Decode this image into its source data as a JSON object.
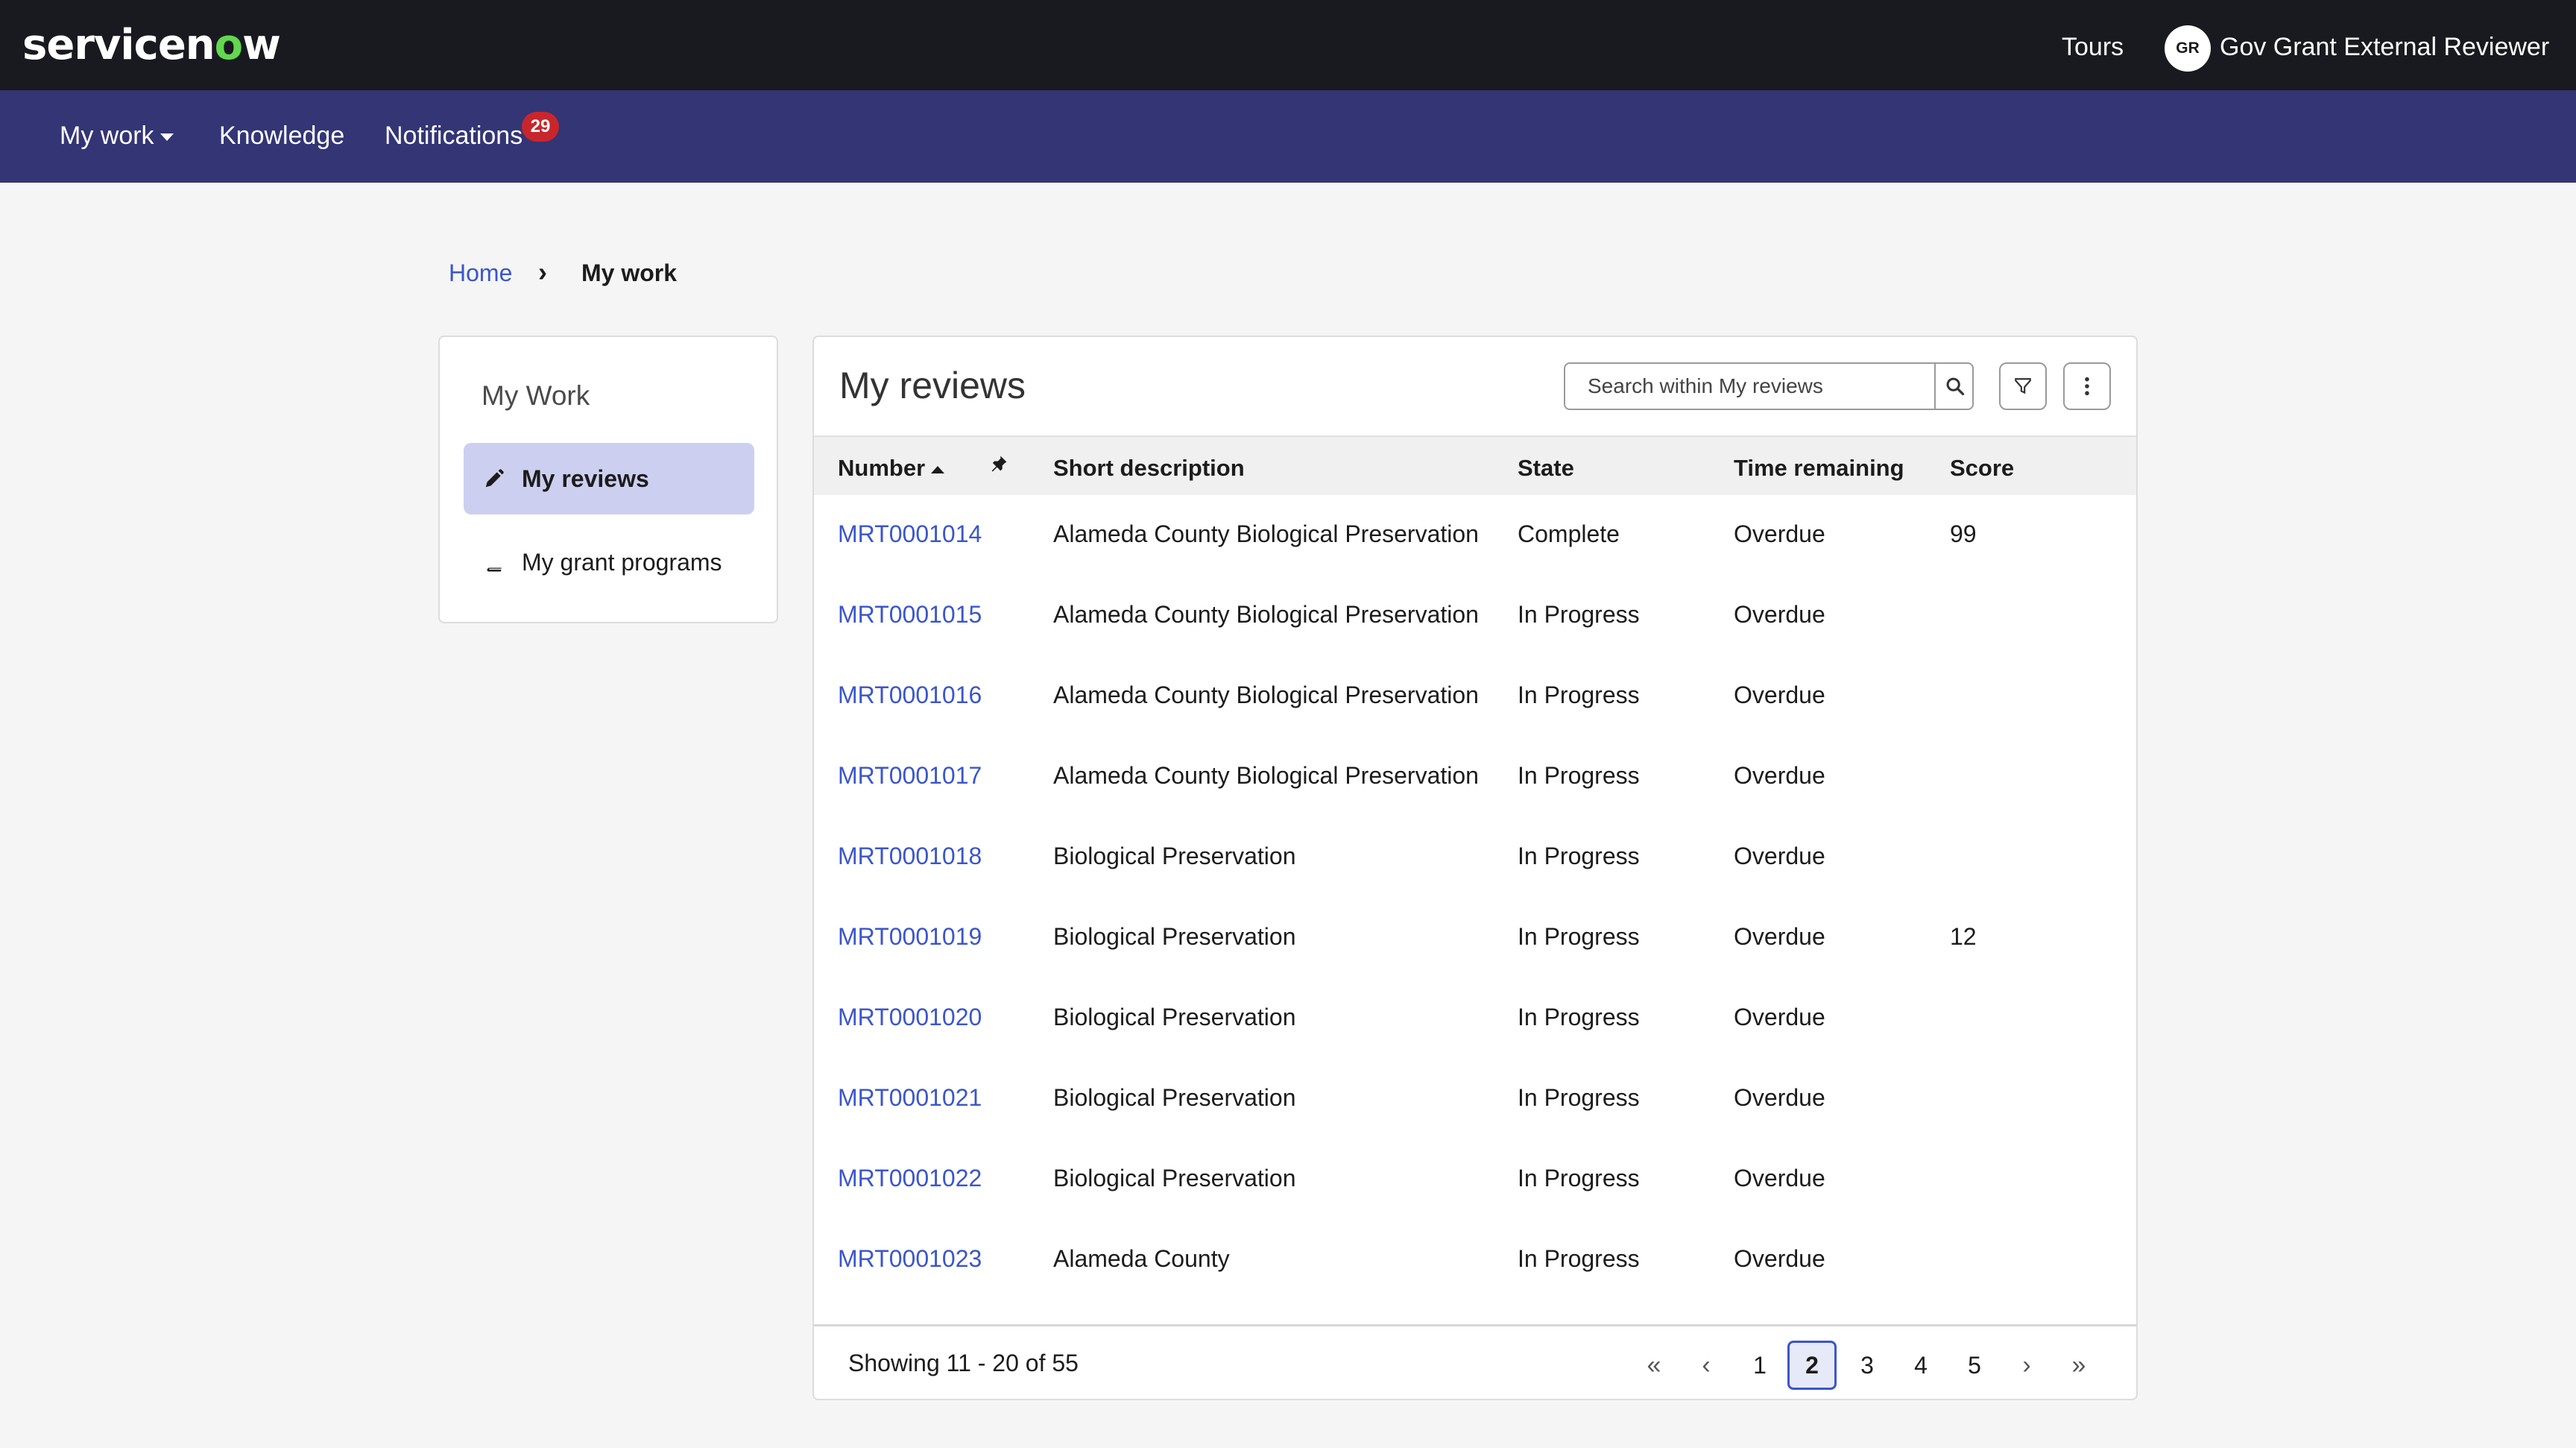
{
  "topbar": {
    "logo_text_a": "servicen",
    "logo_text_o": "o",
    "logo_text_b": "w",
    "tours_label": "Tours",
    "avatar_initials": "GR",
    "user_name": "Gov Grant External Reviewer"
  },
  "nav": {
    "my_work": "My work",
    "knowledge": "Knowledge",
    "notifications": "Notifications",
    "notifications_count": "29"
  },
  "breadcrumb": {
    "home": "Home",
    "separator": "›",
    "current": "My work"
  },
  "sidebar": {
    "title": "My Work",
    "items": [
      {
        "label": "My reviews",
        "icon": "pencil-icon",
        "active": true
      },
      {
        "label": "My grant programs",
        "icon": "book-icon",
        "active": false
      }
    ]
  },
  "main": {
    "title": "My reviews",
    "search_placeholder": "Search within My reviews",
    "columns": [
      "Number",
      "Short description",
      "State",
      "Time remaining",
      "Score"
    ],
    "rows": [
      {
        "number": "MRT0001014",
        "description": "Alameda County Biological Preservation",
        "state": "Complete",
        "time": "Overdue",
        "score": "99"
      },
      {
        "number": "MRT0001015",
        "description": "Alameda County Biological Preservation",
        "state": "In Progress",
        "time": "Overdue",
        "score": ""
      },
      {
        "number": "MRT0001016",
        "description": "Alameda County Biological Preservation",
        "state": "In Progress",
        "time": "Overdue",
        "score": ""
      },
      {
        "number": "MRT0001017",
        "description": "Alameda County Biological Preservation",
        "state": "In Progress",
        "time": "Overdue",
        "score": ""
      },
      {
        "number": "MRT0001018",
        "description": "Biological Preservation",
        "state": "In Progress",
        "time": "Overdue",
        "score": ""
      },
      {
        "number": "MRT0001019",
        "description": "Biological Preservation",
        "state": "In Progress",
        "time": "Overdue",
        "score": "12"
      },
      {
        "number": "MRT0001020",
        "description": "Biological Preservation",
        "state": "In Progress",
        "time": "Overdue",
        "score": ""
      },
      {
        "number": "MRT0001021",
        "description": "Biological Preservation",
        "state": "In Progress",
        "time": "Overdue",
        "score": ""
      },
      {
        "number": "MRT0001022",
        "description": "Biological Preservation",
        "state": "In Progress",
        "time": "Overdue",
        "score": ""
      },
      {
        "number": "MRT0001023",
        "description": "Alameda County",
        "state": "In Progress",
        "time": "Overdue",
        "score": ""
      }
    ],
    "showing": "Showing 11 - 20 of 55",
    "pagination": {
      "first": "«",
      "prev": "‹",
      "pages": [
        "1",
        "2",
        "3",
        "4",
        "5"
      ],
      "current_page": "2",
      "next": "›",
      "last": "»"
    }
  },
  "colors": {
    "topbar_bg": "#191a20",
    "navbar_bg": "#333575",
    "link": "#3b56c9",
    "active_item_bg": "#cdcff0",
    "badge_bg": "#c8262c",
    "logo_accent": "#62d84e"
  }
}
